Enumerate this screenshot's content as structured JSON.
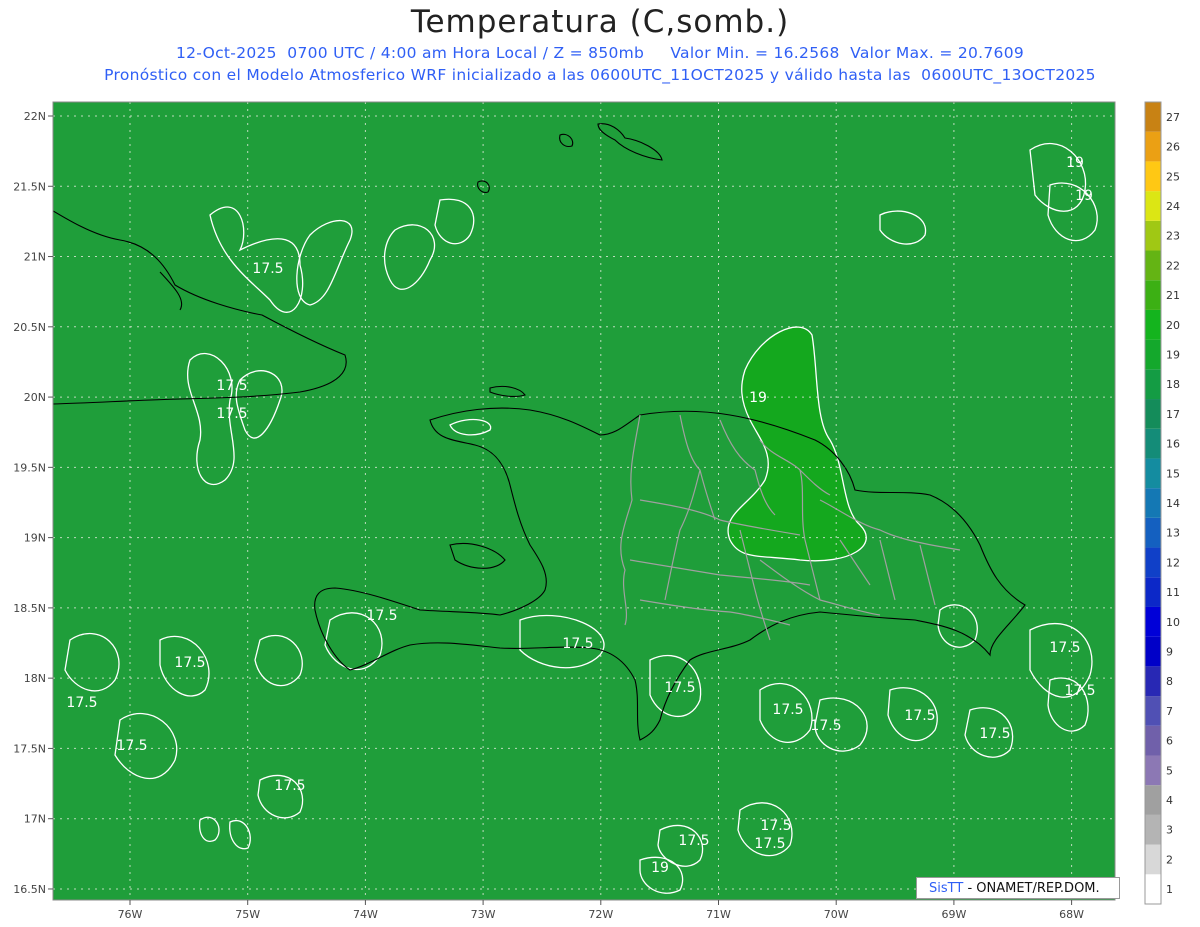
{
  "header": {
    "title": "Temperatura (C,somb.)",
    "subtitle_line1": "12-Oct-2025  0700 UTC / 4:00 am Hora Local / Z = 850mb     Valor Min. = 16.2568  Valor Max. = 20.7609",
    "subtitle_line2": "Pronóstico con el Modelo Atmosferico WRF inicializado a las 0600UTC_11OCT2025 y válido hasta las  0600UTC_13OCT2025"
  },
  "credit": {
    "system": "SisTT",
    "agency": "- ONAMET/REP.DOM."
  },
  "map": {
    "lat_labels": [
      "22N",
      "21.5N",
      "21N",
      "20.5N",
      "20N",
      "19.5N",
      "19N",
      "18.5N",
      "18N",
      "17.5N",
      "17N",
      "16.5N"
    ],
    "lon_labels": [
      "76W",
      "75W",
      "74W",
      "73W",
      "72W",
      "71W",
      "70W",
      "69W",
      "68W"
    ],
    "contour_labels": [
      "17.5",
      "17.5",
      "17.5",
      "17.5",
      "17.5",
      "17.5",
      "17.5",
      "17.5",
      "17.5",
      "17.5",
      "17.5",
      "17.5",
      "17.5",
      "17.5",
      "17.5",
      "17.5",
      "17.5",
      "17.5",
      "17.5",
      "19",
      "19",
      "19",
      "19"
    ],
    "colors": {
      "background_field": "#1f9e3a",
      "warm_field": "#14a81e",
      "contour": "#ffffff",
      "coastline": "#000000",
      "provinces": "#a0a0a0",
      "grid": "#bcdcbc"
    }
  },
  "colorbar": {
    "labels": [
      "1",
      "2",
      "3",
      "4",
      "5",
      "6",
      "7",
      "8",
      "9",
      "10",
      "11",
      "12",
      "13",
      "14",
      "15",
      "16",
      "17",
      "18",
      "19",
      "20",
      "21",
      "22",
      "23",
      "24",
      "25",
      "26",
      "27"
    ],
    "colors": [
      "#ffffff",
      "#d8d8d8",
      "#b4b4b4",
      "#a0a0a0",
      "#8c78b4",
      "#7060aa",
      "#5050b4",
      "#2828b4",
      "#0000c8",
      "#0000d8",
      "#0c28c8",
      "#1040c8",
      "#1460c0",
      "#1478b4",
      "#148ca0",
      "#148c78",
      "#148c5a",
      "#149c44",
      "#14a82c",
      "#14b41e",
      "#3cb014",
      "#64b414",
      "#a0c814",
      "#dce614",
      "#ffc814",
      "#eba014",
      "#c88214"
    ]
  }
}
